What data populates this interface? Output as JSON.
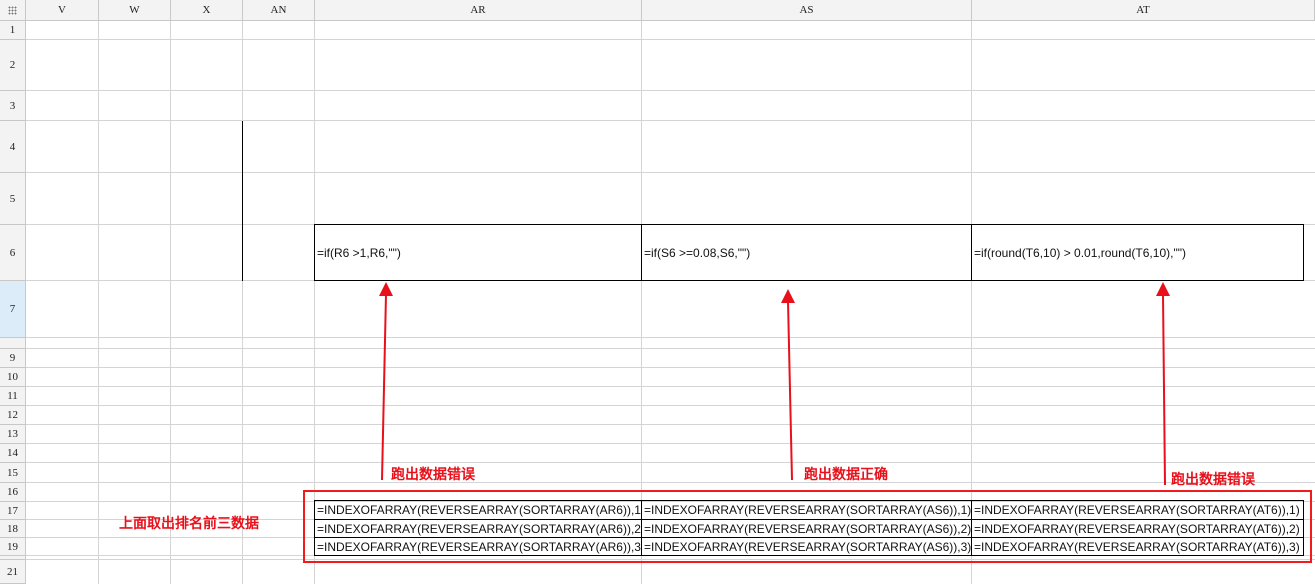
{
  "columns": [
    "V",
    "W",
    "X",
    "AN",
    "AR",
    "AS",
    "AT"
  ],
  "rows": [
    "1",
    "2",
    "3",
    "4",
    "5",
    "6",
    "7",
    "9",
    "10",
    "11",
    "12",
    "13",
    "14",
    "15",
    "16",
    "17",
    "18",
    "19",
    "21"
  ],
  "selected_row": "7",
  "cells": {
    "ar6": "=if(R6 >1,R6,\"\")",
    "as6": "=if(S6 >=0.08,S6,\"\")",
    "at6": "=if(round(T6,10) > 0.01,round(T6,10),\"\")",
    "ar17": "=INDEXOFARRAY(REVERSEARRAY(SORTARRAY(AR6)),1)",
    "as17": "=INDEXOFARRAY(REVERSEARRAY(SORTARRAY(AS6)),1)",
    "at17": "=INDEXOFARRAY(REVERSEARRAY(SORTARRAY(AT6)),1)",
    "ar18": "=INDEXOFARRAY(REVERSEARRAY(SORTARRAY(AR6)),2)",
    "as18": "=INDEXOFARRAY(REVERSEARRAY(SORTARRAY(AS6)),2)",
    "at18": "=INDEXOFARRAY(REVERSEARRAY(SORTARRAY(AT6)),2)",
    "ar19": "=INDEXOFARRAY(REVERSEARRAY(SORTARRAY(AR6)),3)",
    "as19": "=INDEXOFARRAY(REVERSEARRAY(SORTARRAY(AS6)),3)",
    "at19": "=INDEXOFARRAY(REVERSEARRAY(SORTARRAY(AT6)),3)"
  },
  "annotations": {
    "ar_label": "跑出数据错误",
    "as_label": "跑出数据正确",
    "at_label": "跑出数据错误",
    "summary_label": "上面取出排名前三数据"
  },
  "colors": {
    "annotation": "#e8101a",
    "grid": "#d4d4d4",
    "header_bg": "#f3f3f3",
    "selected_row_bg": "#dcecf8"
  }
}
